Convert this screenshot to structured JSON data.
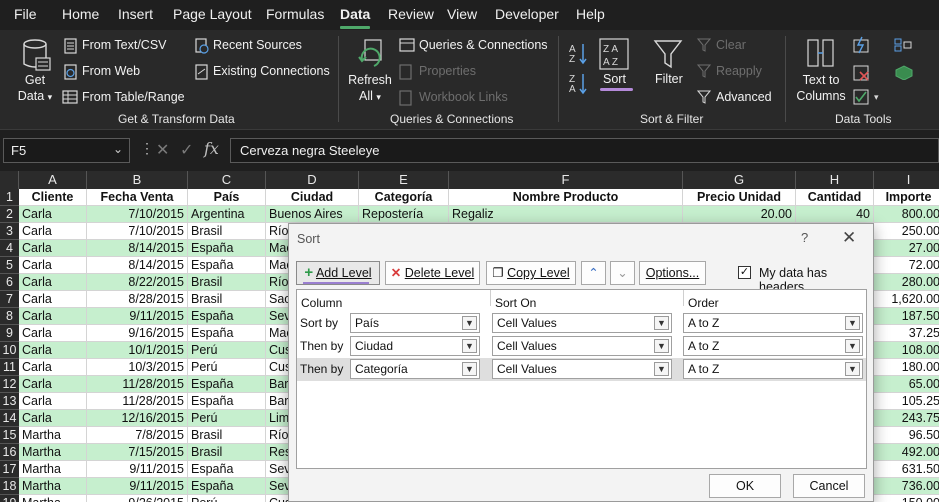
{
  "menu": {
    "tabs": [
      "File",
      "Home",
      "Insert",
      "Page Layout",
      "Formulas",
      "Data",
      "Review",
      "View",
      "Developer",
      "Help"
    ],
    "active_tab": "Data"
  },
  "ribbon": {
    "get_data": {
      "line1": "Get",
      "line2": "Data"
    },
    "from_text_csv": "From Text/CSV",
    "from_web": "From Web",
    "from_table_range": "From Table/Range",
    "recent_sources": "Recent Sources",
    "existing_connections": "Existing Connections",
    "group_get_transform": "Get & Transform Data",
    "refresh_all": {
      "line1": "Refresh",
      "line2": "All"
    },
    "queries_connections": "Queries & Connections",
    "properties": "Properties",
    "workbook_links": "Workbook Links",
    "group_queries": "Queries & Connections",
    "sort": "Sort",
    "filter": "Filter",
    "clear": "Clear",
    "reapply": "Reapply",
    "advanced": "Advanced",
    "group_sort_filter": "Sort & Filter",
    "text_to_columns": {
      "line1": "Text to",
      "line2": "Columns"
    },
    "group_data_tools": "Data Tools"
  },
  "formula_bar": {
    "name_box": "F5",
    "formula": "Cerveza negra Steeleye"
  },
  "sheet": {
    "columns": [
      "A",
      "B",
      "C",
      "D",
      "E",
      "F",
      "G",
      "H",
      "I"
    ],
    "headers": [
      "Cliente",
      "Fecha Venta",
      "País",
      "Ciudad",
      "Categoría",
      "Nombre Producto",
      "Precio Unidad",
      "Cantidad",
      "Importe"
    ],
    "rows": [
      {
        "n": "2",
        "green": true,
        "cells": [
          "Carla",
          "7/10/2015",
          "Argentina",
          "Buenos Aires",
          "Repostería",
          "Regaliz",
          "20.00",
          "40",
          "800.00"
        ]
      },
      {
        "n": "3",
        "green": false,
        "cells": [
          "Carla",
          "7/10/2015",
          "Brasil",
          "Río",
          "",
          "",
          "",
          "",
          "250.00"
        ]
      },
      {
        "n": "4",
        "green": true,
        "cells": [
          "Carla",
          "8/14/2015",
          "España",
          "Mac",
          "",
          "",
          "",
          "",
          "27.00"
        ]
      },
      {
        "n": "5",
        "green": false,
        "cells": [
          "Carla",
          "8/14/2015",
          "España",
          "Mac",
          "",
          "",
          "",
          "",
          "72.00"
        ]
      },
      {
        "n": "6",
        "green": true,
        "cells": [
          "Carla",
          "8/22/2015",
          "Brasil",
          "Río",
          "",
          "",
          "",
          "",
          "280.00"
        ]
      },
      {
        "n": "7",
        "green": false,
        "cells": [
          "Carla",
          "8/28/2015",
          "Brasil",
          "Sao",
          "",
          "",
          "",
          "",
          "1,620.00"
        ]
      },
      {
        "n": "8",
        "green": true,
        "cells": [
          "Carla",
          "9/11/2015",
          "España",
          "Sev",
          "",
          "",
          "",
          "",
          "187.50"
        ]
      },
      {
        "n": "9",
        "green": false,
        "cells": [
          "Carla",
          "9/16/2015",
          "España",
          "Mac",
          "",
          "",
          "",
          "",
          "37.25"
        ]
      },
      {
        "n": "10",
        "green": true,
        "cells": [
          "Carla",
          "10/1/2015",
          "Perú",
          "Cus",
          "",
          "",
          "",
          "",
          "108.00"
        ]
      },
      {
        "n": "11",
        "green": false,
        "cells": [
          "Carla",
          "10/3/2015",
          "Perú",
          "Cus",
          "",
          "",
          "",
          "",
          "180.00"
        ]
      },
      {
        "n": "12",
        "green": true,
        "cells": [
          "Carla",
          "11/28/2015",
          "España",
          "Bar",
          "",
          "",
          "",
          "",
          "65.00"
        ]
      },
      {
        "n": "13",
        "green": false,
        "cells": [
          "Carla",
          "11/28/2015",
          "España",
          "Bar",
          "",
          "",
          "",
          "",
          "105.25"
        ]
      },
      {
        "n": "14",
        "green": true,
        "cells": [
          "Carla",
          "12/16/2015",
          "Perú",
          "Lim",
          "",
          "",
          "",
          "",
          "243.75"
        ]
      },
      {
        "n": "15",
        "green": false,
        "cells": [
          "Martha",
          "7/8/2015",
          "Brasil",
          "Río",
          "",
          "",
          "",
          "",
          "96.50"
        ]
      },
      {
        "n": "16",
        "green": true,
        "cells": [
          "Martha",
          "7/15/2015",
          "Brasil",
          "Res",
          "",
          "",
          "",
          "",
          "492.00"
        ]
      },
      {
        "n": "17",
        "green": false,
        "cells": [
          "Martha",
          "9/11/2015",
          "España",
          "Sev",
          "",
          "",
          "",
          "",
          "631.50"
        ]
      },
      {
        "n": "18",
        "green": true,
        "cells": [
          "Martha",
          "9/11/2015",
          "España",
          "Sev",
          "",
          "",
          "",
          "",
          "736.00"
        ]
      },
      {
        "n": "19",
        "green": false,
        "cells": [
          "Martha",
          "9/26/2015",
          "Perú",
          "Cus",
          "",
          "",
          "",
          "",
          "150.00"
        ]
      }
    ]
  },
  "dialog": {
    "title": "Sort",
    "help": "?",
    "close": "✕",
    "add_level": "Add Level",
    "delete_level": "Delete Level",
    "copy_level": "Copy Level",
    "options": "Options...",
    "has_headers_label": "My data has headers",
    "has_headers_checked": "✓",
    "col_header": "Column",
    "sorton_header": "Sort On",
    "order_header": "Order",
    "levels": [
      {
        "label": "Sort by",
        "column": "País",
        "sort_on": "Cell Values",
        "order": "A to Z"
      },
      {
        "label": "Then by",
        "column": "Ciudad",
        "sort_on": "Cell Values",
        "order": "A to Z"
      },
      {
        "label": "Then by",
        "column": "Categoría",
        "sort_on": "Cell Values",
        "order": "A to Z"
      }
    ],
    "ok": "OK",
    "cancel": "Cancel"
  },
  "colors": {
    "accent_green": "#4fa96a",
    "row_green": "#c6efce",
    "sort_underline": "#b48ad9"
  }
}
